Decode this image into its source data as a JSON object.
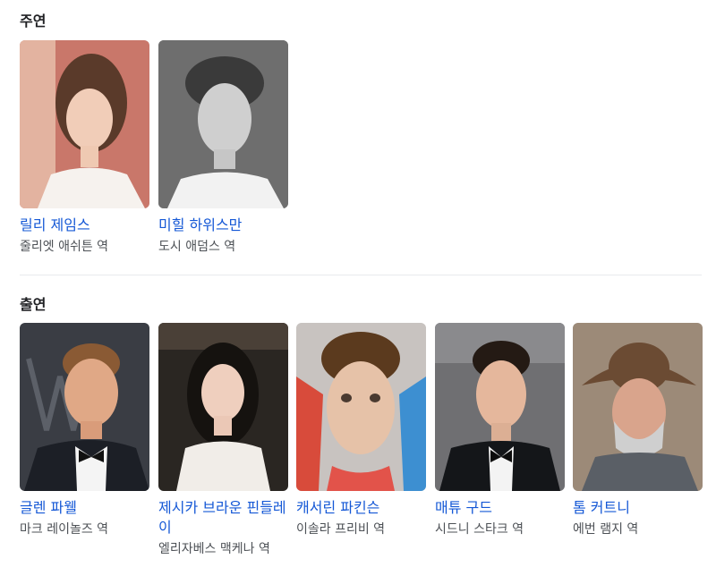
{
  "main_cast": {
    "title": "주연",
    "people": [
      {
        "name": "릴리 제임스",
        "role": "줄리엣 애쉬튼 역"
      },
      {
        "name": "미힐 하위스만",
        "role": "도시 애덤스 역"
      }
    ]
  },
  "supporting_cast": {
    "title": "출연",
    "people": [
      {
        "name": "글렌 파웰",
        "role": "마크 레이놀즈 역"
      },
      {
        "name": "제시카 브라운 핀들레이",
        "role": "엘리자베스 맥케나 역"
      },
      {
        "name": "캐서린 파킨슨",
        "role": "이솔라 프리비 역"
      },
      {
        "name": "매튜 구드",
        "role": "시드니 스타크 역"
      },
      {
        "name": "톰 커트니",
        "role": "에번 램지 역"
      }
    ]
  },
  "colors": {
    "link": "#1558d6",
    "role_text": "#4d5156",
    "divider": "#e8eaed"
  }
}
